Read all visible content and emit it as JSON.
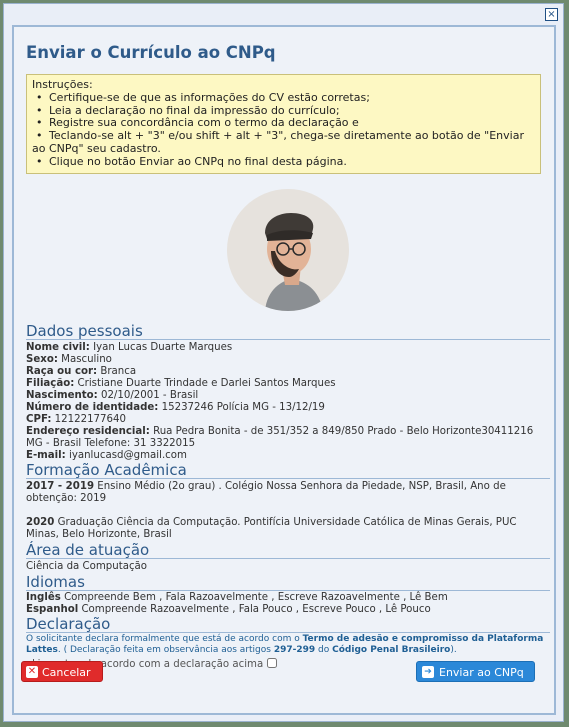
{
  "dialog": {
    "close_label": "×"
  },
  "title": "Enviar o Currículo ao CNPq",
  "instructions": {
    "heading": "Instruções:",
    "items": [
      "Certifique-se de que as informações do CV estão corretas;",
      "Leia a declaração no final da impressão do currículo;",
      "Registre sua concordância com o termo da declaração e",
      "Teclando-se alt + \"3\" e/ou shift + alt + \"3\", chega-se diretamente ao botão de \"Enviar ao CNPq\" seu cadastro.",
      "Clique no botão Enviar ao CNPq no final desta página."
    ]
  },
  "dados": {
    "heading": "Dados pessoais",
    "nome_label": "Nome civil:",
    "nome": "Iyan Lucas Duarte Marques",
    "sexo_label": "Sexo:",
    "sexo": "Masculino",
    "raca_label": "Raça ou cor:",
    "raca": "Branca",
    "filiacao_label": "Filiação:",
    "filiacao": "Cristiane Duarte Trindade e Darlei Santos Marques",
    "nascimento_label": "Nascimento:",
    "nascimento": "02/10/2001 - Brasil",
    "identidade_label": "Número de identidade:",
    "identidade": "15237246 Polícia MG - 13/12/19",
    "cpf_label": "CPF:",
    "cpf": "12122177640",
    "endereco_label": "Endereço residencial:",
    "endereco": "Rua Pedra Bonita - de 351/352 a 849/850 Prado - Belo Horizonte30411216 MG - Brasil Telefone: 31 3322015",
    "email_label": "E-mail:",
    "email": "iyanlucasd@gmail.com"
  },
  "formacao": {
    "heading": "Formação Acadêmica",
    "item1_years": "2017 - 2019",
    "item1_text": "Ensino Médio (2o grau) . Colégio Nossa Senhora da Piedade, NSP, Brasil, Ano de obtenção: 2019",
    "item2_years": "2020",
    "item2_text": "Graduação Ciência da Computação. Pontifícia Universidade Católica de Minas Gerais, PUC Minas, Belo Horizonte, Brasil"
  },
  "atuacao": {
    "heading": "Área de atuação",
    "text": "Ciência da Computação"
  },
  "idiomas": {
    "heading": "Idiomas",
    "ingles_label": "Inglês",
    "ingles": "Compreende Bem , Fala Razoavelmente , Escreve Razoavelmente , Lê Bem",
    "espanhol_label": "Espanhol",
    "espanhol": "Compreende Razoavelmente , Fala Pouco , Escreve Pouco , Lê Pouco"
  },
  "declaracao": {
    "heading": "Declaração",
    "text1": "O solicitante declara formalmente que está de acordo com o",
    "link1": "Termo de adesão e compromisso da Plataforma Lattes",
    "text2": ". ( Declaração feita em observância aos artigos",
    "link2": "297-299",
    "text3": "do",
    "link3": "Código Penal Brasileiro",
    "text4": ").",
    "checkbox_label": "Li e estou de acordo com a declaração acima"
  },
  "buttons": {
    "cancel": "Cancelar",
    "send": "Enviar ao CNPq"
  },
  "colors": {
    "accent": "#2f5b8a",
    "cancel": "#e02b2b",
    "send": "#2b88d8",
    "notice_bg": "#fdf8c3"
  }
}
